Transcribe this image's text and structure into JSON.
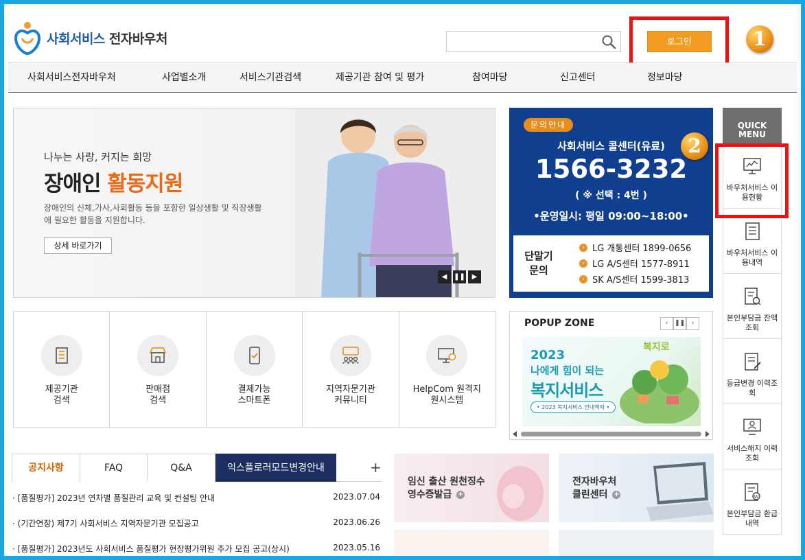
{
  "header": {
    "logo_main": "사회서비스",
    "logo_sub": "전자바우처",
    "login_label": "로그인",
    "annotation_1": "1",
    "annotation_2": "2"
  },
  "gnb": [
    "사회서비스전자바우처",
    "사업별소개",
    "서비스기관검색",
    "제공기관 참여 및 평가",
    "참여마당",
    "신고센터",
    "정보마당"
  ],
  "banner": {
    "subtitle": "나누는 사랑, 커지는 희망",
    "title_main": "장애인",
    "title_accent": "활동지원",
    "desc": "장애인의 신체,가사,사회활동 등을 포함한 일상생활 및 직장생활에 필요한 활동을 지원합니다.",
    "more_label": "상세 바로가기"
  },
  "callcenter": {
    "tag": "문의안내",
    "title": "사회서비스 콜센터(유료)",
    "phone": "1566-3232",
    "select": "( ※ 선택 : 4번 )",
    "hours": "•운영일시: 평일 09:00~18:00•",
    "terminal_label": "단말기 문의",
    "terminals": [
      "LG 개통센터 1899-0656",
      "LG A/S센터 1577-8911",
      "SK A/S센터 1599-3813"
    ]
  },
  "quick": {
    "title": "QUICK MENU",
    "items": [
      {
        "label": "바우처서비스 이용현황",
        "icon": "monitor-chart-icon"
      },
      {
        "label": "바우처서비스 이용내역",
        "icon": "document-list-icon"
      },
      {
        "label": "본인부담금 잔액조회",
        "icon": "document-search-icon"
      },
      {
        "label": "등급변경 이력조회",
        "icon": "document-edit-icon"
      },
      {
        "label": "서비스해지 이력조회",
        "icon": "monitor-user-icon"
      },
      {
        "label": "본인부담금 환급내역",
        "icon": "document-won-icon"
      }
    ]
  },
  "services": [
    {
      "label": "제공기관 검색",
      "icon": "building-icon"
    },
    {
      "label": "판매점 검색",
      "icon": "store-icon"
    },
    {
      "label": "결제가능 스마트폰",
      "icon": "smartphone-icon"
    },
    {
      "label": "지역자문기관 커뮤니티",
      "icon": "community-icon"
    },
    {
      "label": "HelpCom 원격지원시스템",
      "icon": "remote-support-icon"
    }
  ],
  "popup": {
    "title": "POPUP ZONE",
    "year": "2023",
    "line1": "나에게 힘이 되는",
    "line2": "복지서비스",
    "pill": "• 2023 복지서비스 안내책자 •",
    "brand": "복지로"
  },
  "notices": {
    "tabs": [
      "공지사항",
      "FAQ",
      "Q&A",
      "익스플로러모드변경안내"
    ],
    "more": "+",
    "items": [
      {
        "title": "[품질평가] 2023년 연차별 품질관리 교육 및 컨설팅 안내",
        "date": "2023.07.04"
      },
      {
        "title": "(기간연장) 제7기 사회서비스 지역자문기관 모집공고",
        "date": "2023.06.26"
      },
      {
        "title": "[품질평가] 2023년도 사회서비스 품질평가 현장평가위원 추가 모집 공고(상시)",
        "date": "2023.05.16"
      }
    ]
  },
  "promos": [
    {
      "line1": "임신 출산 원천징수",
      "line2": "영수증발급"
    },
    {
      "line1": "전자바우처",
      "line2": "클린센터"
    }
  ],
  "colors": {
    "frame": "#19a7e2",
    "accent": "#f49b22",
    "navy": "#113f8f",
    "highlight": "#ee1111"
  }
}
